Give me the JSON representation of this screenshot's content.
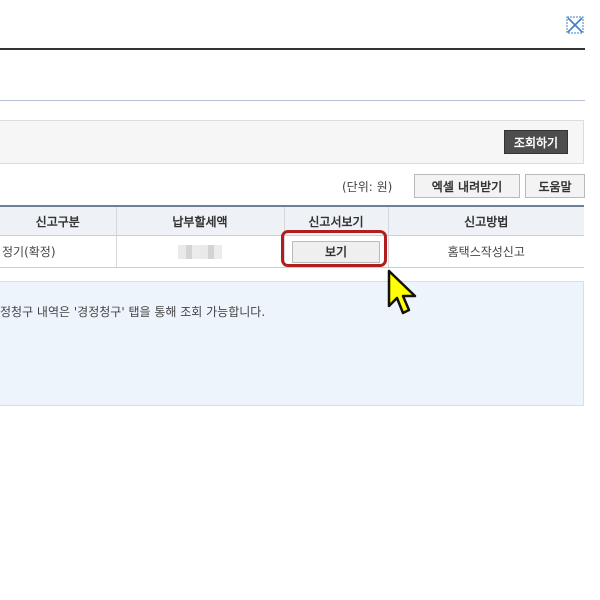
{
  "header": {
    "close_icon": "close-x-icon"
  },
  "search": {
    "search_button": "조회하기"
  },
  "toolbar": {
    "unit_label": "(단위: 원)",
    "excel_button": "엑셀 내려받기",
    "help_button": "도움말"
  },
  "table": {
    "headers": [
      "신고구분",
      "납부할세액",
      "신고서보기",
      "신고방법"
    ],
    "rows": [
      {
        "type": "정기(확정)",
        "tax": "",
        "view_button": "보기",
        "method": "홈택스작성신고"
      }
    ]
  },
  "notice": {
    "text": "정청구 내역은  '경정청구' 탭을 통해 조회 가능합니다."
  },
  "colors": {
    "highlight": "#b01e1e",
    "cursor_fill": "#ffff00",
    "header_bg": "#eef1f6",
    "notice_bg": "#eef4fb"
  }
}
